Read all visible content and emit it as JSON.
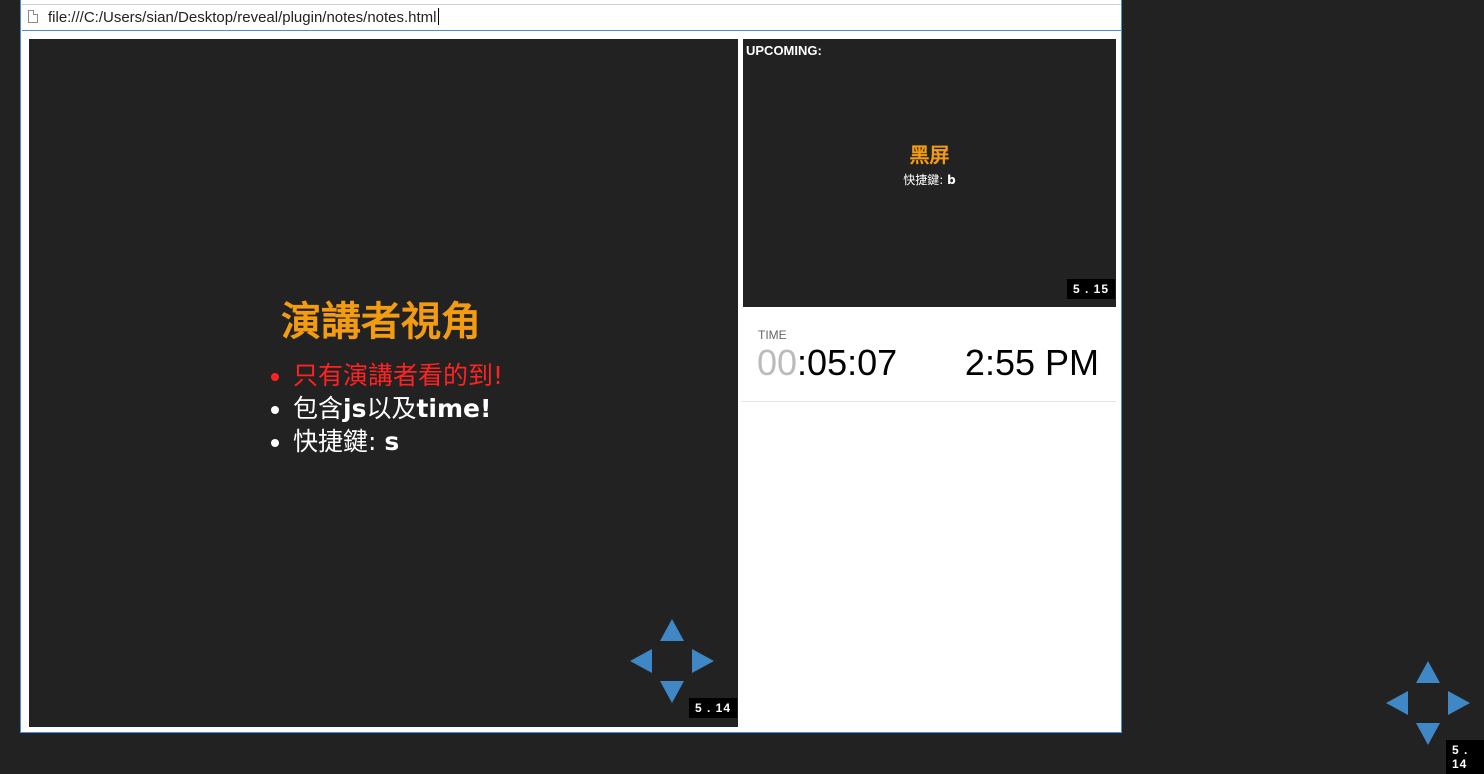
{
  "browser": {
    "url": "file:///C:/Users/sian/Desktop/reveal/plugin/notes/notes.html"
  },
  "current_slide": {
    "title": "演講者視角",
    "bullets": [
      {
        "text": "只有演講者看的到!",
        "color": "#ff2222"
      },
      {
        "text_pre": "包含",
        "bold1": "js",
        "text_mid": "以及",
        "bold2": "time!"
      },
      {
        "text_pre": "快捷鍵: ",
        "bold1": "s"
      }
    ],
    "slide_number": "5 . 14"
  },
  "upcoming": {
    "label": "UPCOMING:",
    "title": "黑屏",
    "subtitle_pre": "快捷鍵: ",
    "subtitle_key": "b",
    "slide_number": "5 . 15"
  },
  "time": {
    "label": "TIME",
    "hours": "00",
    "rest": ":05:07",
    "clock": "2:55 PM"
  },
  "background_presentation": {
    "slide_number": "5 . 14"
  },
  "colors": {
    "accent": "#f39c12",
    "arrows": "#3f88c5",
    "background": "#222222"
  },
  "icons": [
    "page-icon",
    "arrow-up-icon",
    "arrow-down-icon",
    "arrow-left-icon",
    "arrow-right-icon"
  ]
}
